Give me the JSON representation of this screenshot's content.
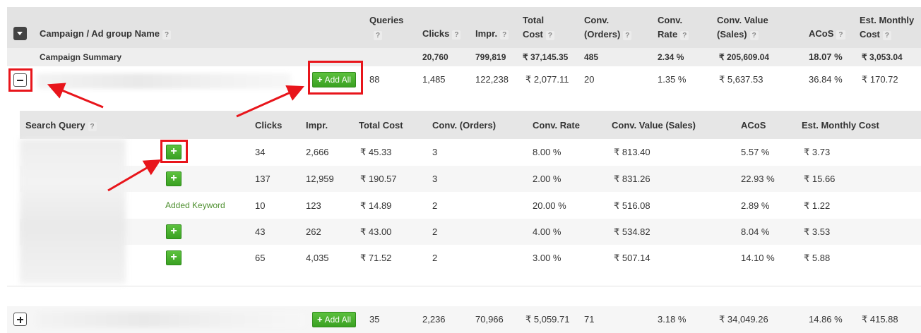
{
  "header": {
    "name_label": "Campaign / Ad group Name",
    "queries_label_1": "Queries",
    "clicks_label": "Clicks",
    "impr_label": "Impr.",
    "total_cost_label_1": "Total",
    "total_cost_label_2": "Cost",
    "conv_orders_label_1": "Conv.",
    "conv_orders_label_2": "(Orders)",
    "conv_rate_label_1": "Conv.",
    "conv_rate_label_2": "Rate",
    "conv_value_label_1": "Conv. Value",
    "conv_value_label_2": "(Sales)",
    "acos_label": "ACoS",
    "est_cost_label_1": "Est. Monthly",
    "est_cost_label_2": "Cost",
    "help_glyph": "?"
  },
  "summary": {
    "label": "Campaign Summary",
    "clicks": "20,760",
    "impr": "799,819",
    "total_cost": "₹ 37,145.35",
    "conv_orders": "485",
    "conv_rate": "2.34 %",
    "conv_value": "₹ 205,609.04",
    "acos": "18.07 %",
    "est_cost": "₹ 3,053.04"
  },
  "campaign_rows": [
    {
      "toggle": "minus",
      "add_all_label": "Add All",
      "queries": "88",
      "clicks": "1,485",
      "impr": "122,238",
      "total_cost": "₹ 2,077.11",
      "conv_orders": "20",
      "conv_rate": "1.35 %",
      "conv_value": "₹ 5,637.53",
      "acos": "36.84 %",
      "est_cost": "₹ 170.72"
    },
    {
      "toggle": "plus",
      "add_all_label": "Add All",
      "queries": "35",
      "clicks": "2,236",
      "impr": "70,966",
      "total_cost": "₹ 5,059.71",
      "conv_orders": "71",
      "conv_rate": "3.18 %",
      "conv_value": "₹ 34,049.26",
      "acos": "14.86 %",
      "est_cost": "₹ 415.88"
    }
  ],
  "sub_table": {
    "headers": {
      "search_query": "Search Query",
      "clicks": "Clicks",
      "impr": "Impr.",
      "total_cost": "Total Cost",
      "conv_orders": "Conv. (Orders)",
      "conv_rate": "Conv. Rate",
      "conv_value": "Conv. Value (Sales)",
      "acos": "ACoS",
      "est_cost": "Est. Monthly Cost"
    },
    "added_label": "Added Keyword",
    "rows": [
      {
        "status": "add",
        "clicks": "34",
        "impr": "2,666",
        "total_cost": "₹ 45.33",
        "conv_orders": "3",
        "conv_rate": "8.00 %",
        "conv_value": "₹ 813.40",
        "acos": "5.57 %",
        "est_cost": "₹ 3.73"
      },
      {
        "status": "add",
        "clicks": "137",
        "impr": "12,959",
        "total_cost": "₹ 190.57",
        "conv_orders": "3",
        "conv_rate": "2.00 %",
        "conv_value": "₹ 831.26",
        "acos": "22.93 %",
        "est_cost": "₹ 15.66"
      },
      {
        "status": "added",
        "clicks": "10",
        "impr": "123",
        "total_cost": "₹ 14.89",
        "conv_orders": "2",
        "conv_rate": "20.00 %",
        "conv_value": "₹ 516.08",
        "acos": "2.89 %",
        "est_cost": "₹ 1.22"
      },
      {
        "status": "add",
        "clicks": "43",
        "impr": "262",
        "total_cost": "₹ 43.00",
        "conv_orders": "2",
        "conv_rate": "4.00 %",
        "conv_value": "₹ 534.82",
        "acos": "8.04 %",
        "est_cost": "₹ 3.53"
      },
      {
        "status": "add",
        "clicks": "65",
        "impr": "4,035",
        "total_cost": "₹ 71.52",
        "conv_orders": "2",
        "conv_rate": "3.00 %",
        "conv_value": "₹ 507.14",
        "acos": "14.10 %",
        "est_cost": "₹ 5.88"
      }
    ]
  },
  "colors": {
    "header_bg": "#e3e3e3",
    "summary_bg": "#eeeeee",
    "add_green": "#3aa122",
    "added_text": "#4d8f2e",
    "annotation_red": "#e8151b"
  },
  "icons": {
    "collapse_all": "caret-down-icon",
    "expanded_toggle": "minus-icon",
    "collapsed_toggle": "plus-icon",
    "add_keyword": "plus-icon"
  }
}
